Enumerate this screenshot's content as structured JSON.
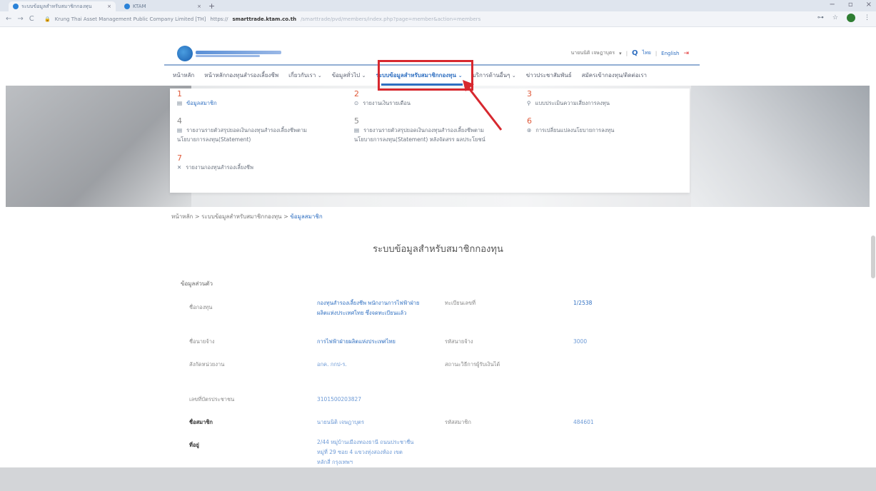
{
  "browser": {
    "tabs": [
      {
        "label": "ระบบข้อมูลสำหรับสมาชิกกองทุน",
        "close": "×"
      },
      {
        "label": "KTAM",
        "close": "×"
      }
    ],
    "new_tab": "+",
    "window_controls": {
      "minimize": "−",
      "restore": "▫",
      "close": "×"
    },
    "nav": {
      "back": "←",
      "forward": "→",
      "reload": "C"
    },
    "address": {
      "site_identity": "Krung Thai Asset Management Public Company Limited [TH]",
      "scheme": "https://",
      "host": "smarttrade.ktam.co.th",
      "path": "/smarttrade/pvd/members/index.php?page=member&action=members"
    },
    "right_icons": {
      "key": "⊶",
      "star": "☆",
      "more": "⋮"
    }
  },
  "header": {
    "user_name": "นายนนิติ เจษฎาบุตร",
    "user_chevron": "▾",
    "search_icon": "Q",
    "lang_th": "ไทย",
    "lang_sep": "|",
    "lang_en": "English",
    "logout_icon": "⇥"
  },
  "nav": {
    "items": [
      {
        "label": "หน้าหลัก",
        "chevron": ""
      },
      {
        "label": "หน้าหลักกองทุนสำรองเลี้ยงชีพ",
        "chevron": ""
      },
      {
        "label": "เกี่ยวกับเรา",
        "chevron": "⌄"
      },
      {
        "label": "ข้อมูลทั่วไป",
        "chevron": "⌄"
      },
      {
        "label": "ระบบข้อมูลสำหรับสมาชิกกองทุน",
        "chevron": "⌄",
        "active": true
      },
      {
        "label": "บริการด้านอื่นๆ",
        "chevron": "⌄"
      },
      {
        "label": "ข่าวประชาสัมพันธ์",
        "chevron": ""
      },
      {
        "label": "สมัครเข้ากองทุน/ติดต่อเรา",
        "chevron": ""
      }
    ]
  },
  "dropdown": {
    "items": [
      {
        "num": "1",
        "icon": "▤",
        "label": "ข้อมูลสมาชิก",
        "active": true
      },
      {
        "num": "2",
        "icon": "⊙",
        "label": "รายงานเงินรายเดือน"
      },
      {
        "num": "3",
        "icon": "⚲",
        "label": "แบบประเมินความเสี่ยงการลงทุน"
      },
      {
        "num": "4",
        "icon": "▤",
        "label": "รายงานรายตัวสรุปยอดเงินกองทุนสำรองเลี้ยงชีพตาม",
        "label2": "นโยบายการลงทุน(Statement)"
      },
      {
        "num": "5",
        "icon": "▤",
        "label": "รายงานรายตัวสรุปยอดเงินกองทุนสำรองเลี้ยงชีพตาม",
        "label2": "นโยบายการลงทุน(Statement) หลังจัดสรร ผลประโยชน์"
      },
      {
        "num": "6",
        "icon": "⊛",
        "label": "การเปลี่ยนแปลงนโยบายการลงทุน"
      },
      {
        "num": "7",
        "icon": "✕",
        "label": "รายงานกองทุนสำรองเลี้ยงชีพ"
      }
    ]
  },
  "breadcrumb": {
    "home": "หน้าหลัก",
    "sep1": ">",
    "section": "ระบบข้อมูลสำหรับสมาชิกกองทุน",
    "sep2": ">",
    "current": "ข้อมูลสมาชิก"
  },
  "page": {
    "title": "ระบบข้อมูลสำหรับสมาชิกกองทุน",
    "section_title": "ข้อมูลส่วนตัว"
  },
  "fields": {
    "fund_name_label": "ชื่อกองทุน",
    "fund_name_line1": "กองทุนสำรองเลี้ยงชีพ พนักงานการไฟฟ้าฝ่าย",
    "fund_name_line2": "ผลิตแห่งประเทศไทย ซึ่งจดทะเบียนแล้ว",
    "reg_no_label": "ทะเบียนเลขที่",
    "reg_no_value": "1/2538",
    "employer_label": "ชื่อนายจ้าง",
    "employer_value": "การไฟฟ้าฝ่ายผลิตแห่งประเทศไทย",
    "employer_code_label": "รหัสนายจ้าง",
    "employer_code_value": "3000",
    "dept_label": "สังกัดหน่วยงาน",
    "dept_value": "อกค. กกป-ร.",
    "status_label": "สถานะวิธีการผู้รับเงินได้",
    "status_value": "",
    "id_label": "เลขที่บัตรประชาชน",
    "id_value": "3101500203827",
    "member_label": "ชื่อสมาชิก",
    "member_value": "นายนนิติ เจษฎาบุตร",
    "member_code_label": "รหัสสมาชิก",
    "member_code_value": "484601",
    "address_label": "ที่อยู่",
    "address_line1": "2/44 หมู่บ้านเมืองทองธานี ถนนประชาชื่น",
    "address_line2": "หมู่ที่ 29 ซอย 4 แขวงทุ่งสองห้อง เขต",
    "address_line3": "หลักสี่ กรุงเทพฯ"
  },
  "colors": {
    "accent": "#2f6fc1",
    "highlight": "#d7282f",
    "number_marker": "#e05a3a"
  }
}
